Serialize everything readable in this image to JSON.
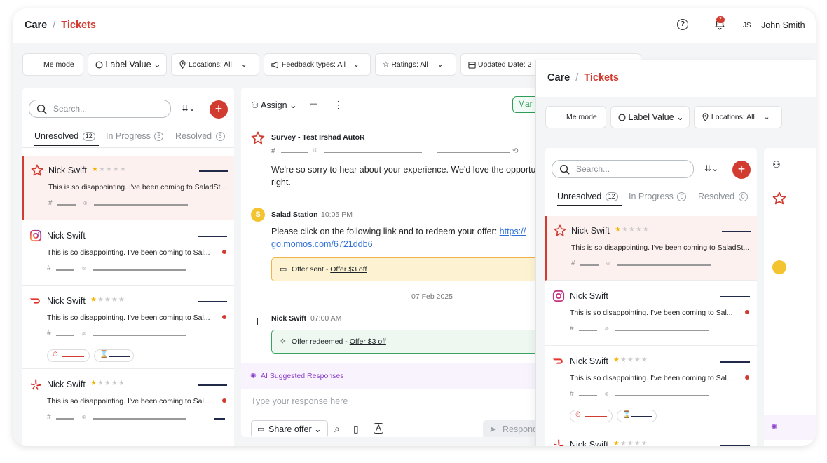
{
  "breadcrumb": {
    "root": "Care",
    "sep": "/",
    "current": "Tickets"
  },
  "header": {
    "notification_count": "2",
    "initials": "JS",
    "user_name": "John Smith"
  },
  "filters": {
    "me_mode": "Me mode",
    "label_value": "Label Value",
    "locations": "Locations: All",
    "feedback_types": "Feedback types: All",
    "ratings": "Ratings: All",
    "updated_date": "Updated Date: 2"
  },
  "list": {
    "search_placeholder": "Search...",
    "add_label": "+",
    "tabs": [
      {
        "label": "Unresolved",
        "count": "12"
      },
      {
        "label": "In Progress",
        "count": "6"
      },
      {
        "label": "Resolved",
        "count": "6"
      }
    ],
    "tickets": [
      {
        "name": "Nick Swift",
        "rating": 1,
        "message": "This is so disappointing. I've been coming to SaladSt...",
        "source_icon": "momos-star-icon"
      },
      {
        "name": "Nick Swift",
        "rating": 0,
        "message": "This is so disappointing. I've been coming to Sal...",
        "source_icon": "instagram-icon"
      },
      {
        "name": "Nick Swift",
        "rating": 1,
        "message": "This is so disappointing. I've been coming to Sal...",
        "source_icon": "doordash-icon"
      },
      {
        "name": "Nick Swift",
        "rating": 1,
        "message": "This is so disappointing. I've been coming to Sal...",
        "source_icon": "yelp-icon"
      }
    ]
  },
  "conversation": {
    "assign_label": "Assign",
    "mark_label": "Mar",
    "survey_title": "Survey - Test Irshad AutoR",
    "survey_hash": "#",
    "survey_text_1": "We're so sorry to hear about your experience. We'd love the opportu",
    "survey_text_2": "right.",
    "brand_initial": "S",
    "brand_name": "Salad Station",
    "brand_time": "10:05 PM",
    "brand_text": "Please click on the following link and to redeem your offer: ",
    "brand_link_1": "https://",
    "brand_link_2": "go.momos.com/6721ddb6",
    "offer_sent_prefix": "Offer sent - ",
    "offer_sent_value": "Offer $3 off",
    "date_divider": "07 Feb 2025",
    "customer_name": "Nick Swift",
    "customer_time": "07:00 AM",
    "offer_redeemed_prefix": "Offer redeemed - ",
    "offer_redeemed_value": "Offer $3 off",
    "ai_suggested": "AI Suggested Responses",
    "reply_placeholder": "Type your response here",
    "share_offer": "Share offer",
    "respond": "Respond"
  },
  "colors": {
    "brand_red": "#d23b30",
    "success_green": "#2e9d58",
    "warning_yellow": "#fdf0c8",
    "ai_purple": "#8a3fc8"
  }
}
